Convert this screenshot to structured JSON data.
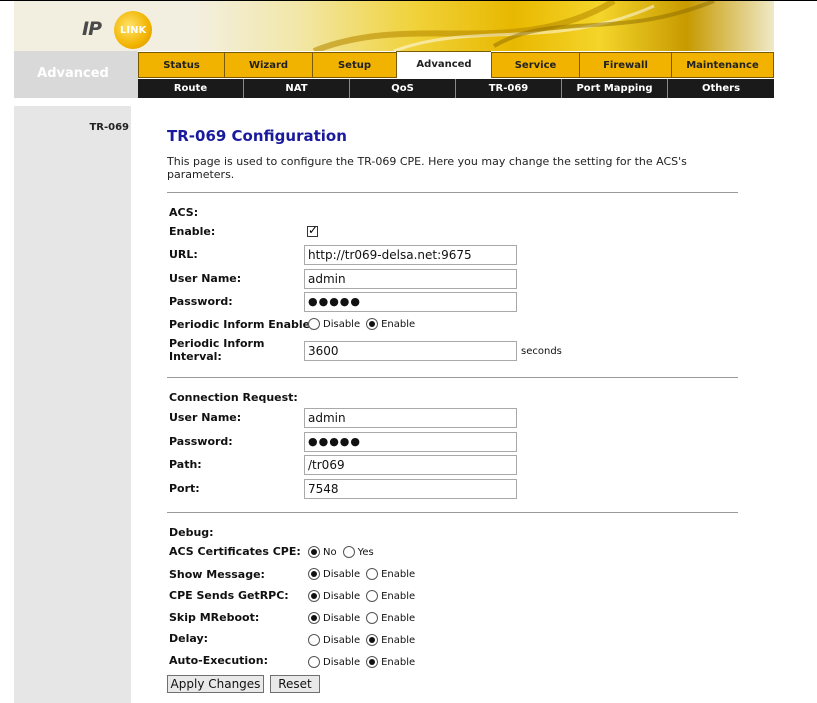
{
  "logo": {
    "ip": "IP",
    "link": "LINK"
  },
  "sidebar_heading": "Advanced",
  "main_tabs": [
    {
      "label": "Status",
      "width": 86
    },
    {
      "label": "Wizard",
      "width": 88
    },
    {
      "label": "Setup",
      "width": 84
    },
    {
      "label": "Advanced",
      "width": 95
    },
    {
      "label": "Service",
      "width": 88
    },
    {
      "label": "Firewall",
      "width": 92
    },
    {
      "label": "Maintenance",
      "width": 103
    }
  ],
  "sub_tabs": [
    {
      "label": "Route",
      "width": 106
    },
    {
      "label": "NAT",
      "width": 106
    },
    {
      "label": "QoS",
      "width": 106
    },
    {
      "label": "TR-069",
      "width": 106
    },
    {
      "label": "Port Mapping",
      "width": 106
    },
    {
      "label": "Others",
      "width": 106
    }
  ],
  "nav": {
    "current": "TR-069"
  },
  "page": {
    "title": "TR-069 Configuration",
    "description": "This page is used to configure the TR-069 CPE. Here you may change the setting for the ACS's parameters."
  },
  "acs": {
    "heading": "ACS:",
    "enable_label": "Enable:",
    "enable_checked": true,
    "url_label": "URL:",
    "url_value": "http://tr069-delsa.net:9675",
    "username_label": "User Name:",
    "username_value": "admin",
    "password_label": "Password:",
    "password_value": "●●●●●",
    "periodic_label": "Periodic Inform Enable:",
    "periodic_disable": "Disable",
    "periodic_enable": "Enable",
    "interval_label_1": "Periodic Inform",
    "interval_label_2": "Interval:",
    "interval_value": "3600",
    "interval_unit": "seconds"
  },
  "connection": {
    "heading": "Connection Request:",
    "username_label": "User Name:",
    "username_value": "admin",
    "password_label": "Password:",
    "password_value": "●●●●●",
    "path_label": "Path:",
    "path_value": "/tr069",
    "port_label": "Port:",
    "port_value": "7548"
  },
  "debug": {
    "heading": "Debug:",
    "rows": [
      {
        "label": "ACS Certificates CPE:",
        "opt1": "No",
        "opt2": "Yes",
        "selected": 1
      },
      {
        "label": "Show Message:",
        "opt1": "Disable",
        "opt2": "Enable",
        "selected": 1
      },
      {
        "label": "CPE Sends GetRPC:",
        "opt1": "Disable",
        "opt2": "Enable",
        "selected": 1
      },
      {
        "label": "Skip MReboot:",
        "opt1": "Disable",
        "opt2": "Enable",
        "selected": 1
      },
      {
        "label": "Delay:",
        "opt1": "Disable",
        "opt2": "Enable",
        "selected": 2
      },
      {
        "label": "Auto-Execution:",
        "opt1": "Disable",
        "opt2": "Enable",
        "selected": 2
      }
    ]
  },
  "buttons": {
    "apply": "Apply Changes",
    "reset": "Reset"
  }
}
